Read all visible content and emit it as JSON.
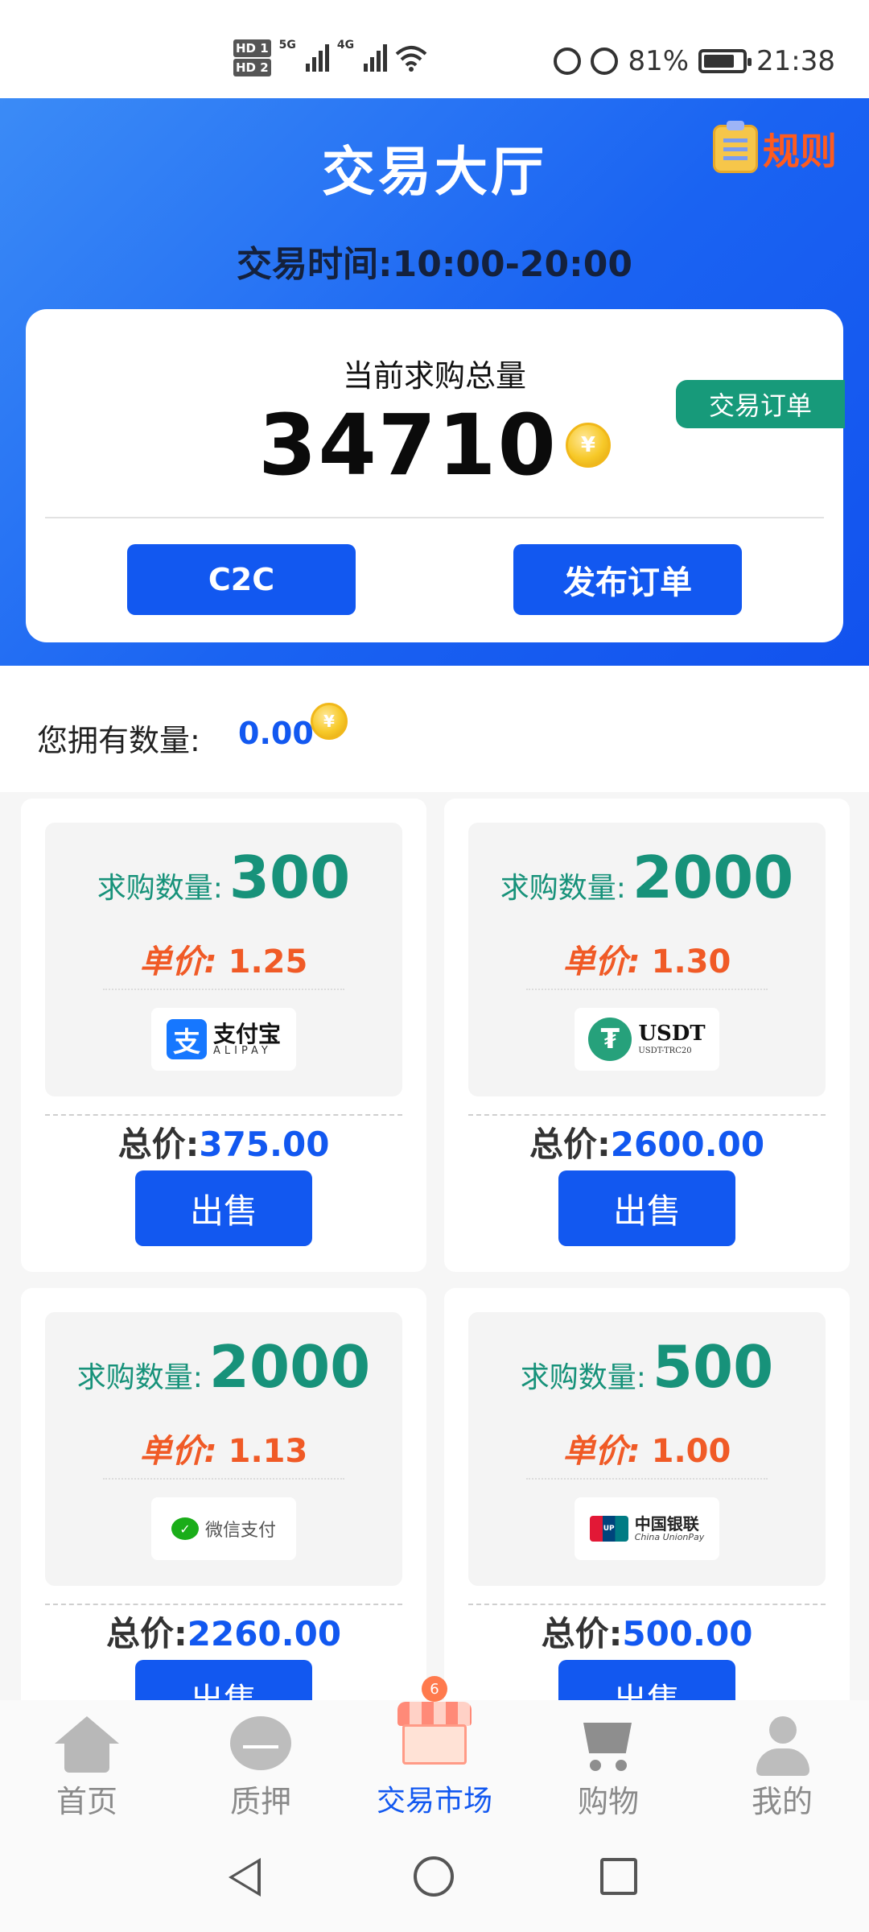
{
  "status_bar": {
    "hd1": "HD 1",
    "hd2": "HD 2",
    "net1": "5G",
    "net2": "4G",
    "battery_percent": "81%",
    "time": "21:38"
  },
  "header": {
    "title": "交易大厅",
    "rules_label": "规则",
    "trade_hours": "交易时间:10:00-20:00"
  },
  "summary": {
    "label": "当前求购总量",
    "value": "34710",
    "coin_glyph": "¥",
    "orders_button": "交易订单",
    "c2c_button": "C2C",
    "publish_button": "发布订单"
  },
  "owned": {
    "label": "您拥有数量:",
    "value": "0.00"
  },
  "orders": [
    {
      "qty_label": "求购数量:",
      "qty": "300",
      "price_label": "单价:",
      "price": "1.25",
      "payment": "alipay",
      "pay_cn": "支付宝",
      "pay_en": "ALIPAY",
      "total_label": "总价:",
      "total": "375.00",
      "sell_label": "出售"
    },
    {
      "qty_label": "求购数量:",
      "qty": "2000",
      "price_label": "单价:",
      "price": "1.30",
      "payment": "usdt",
      "pay_cn": "USDT",
      "pay_en": "USDT-TRC20",
      "total_label": "总价:",
      "total": "2600.00",
      "sell_label": "出售"
    },
    {
      "qty_label": "求购数量:",
      "qty": "2000",
      "price_label": "单价:",
      "price": "1.13",
      "payment": "wechat",
      "pay_cn": "微信支付",
      "pay_en": "",
      "total_label": "总价:",
      "total": "2260.00",
      "sell_label": "出售"
    },
    {
      "qty_label": "求购数量:",
      "qty": "500",
      "price_label": "单价:",
      "price": "1.00",
      "payment": "unionpay",
      "pay_cn": "中国银联",
      "pay_en": "China UnionPay",
      "total_label": "总价:",
      "total": "500.00",
      "sell_label": "出售"
    }
  ],
  "tabs": [
    {
      "label": "首页",
      "icon": "home-icon"
    },
    {
      "label": "质押",
      "icon": "pledge-icon"
    },
    {
      "label": "交易市场",
      "icon": "market-icon",
      "badge": "6",
      "active": true
    },
    {
      "label": "购物",
      "icon": "cart-icon"
    },
    {
      "label": "我的",
      "icon": "profile-icon"
    }
  ],
  "colors": {
    "primary": "#1258f0",
    "accent_orange": "#f05a26",
    "accent_green": "#17927a"
  }
}
